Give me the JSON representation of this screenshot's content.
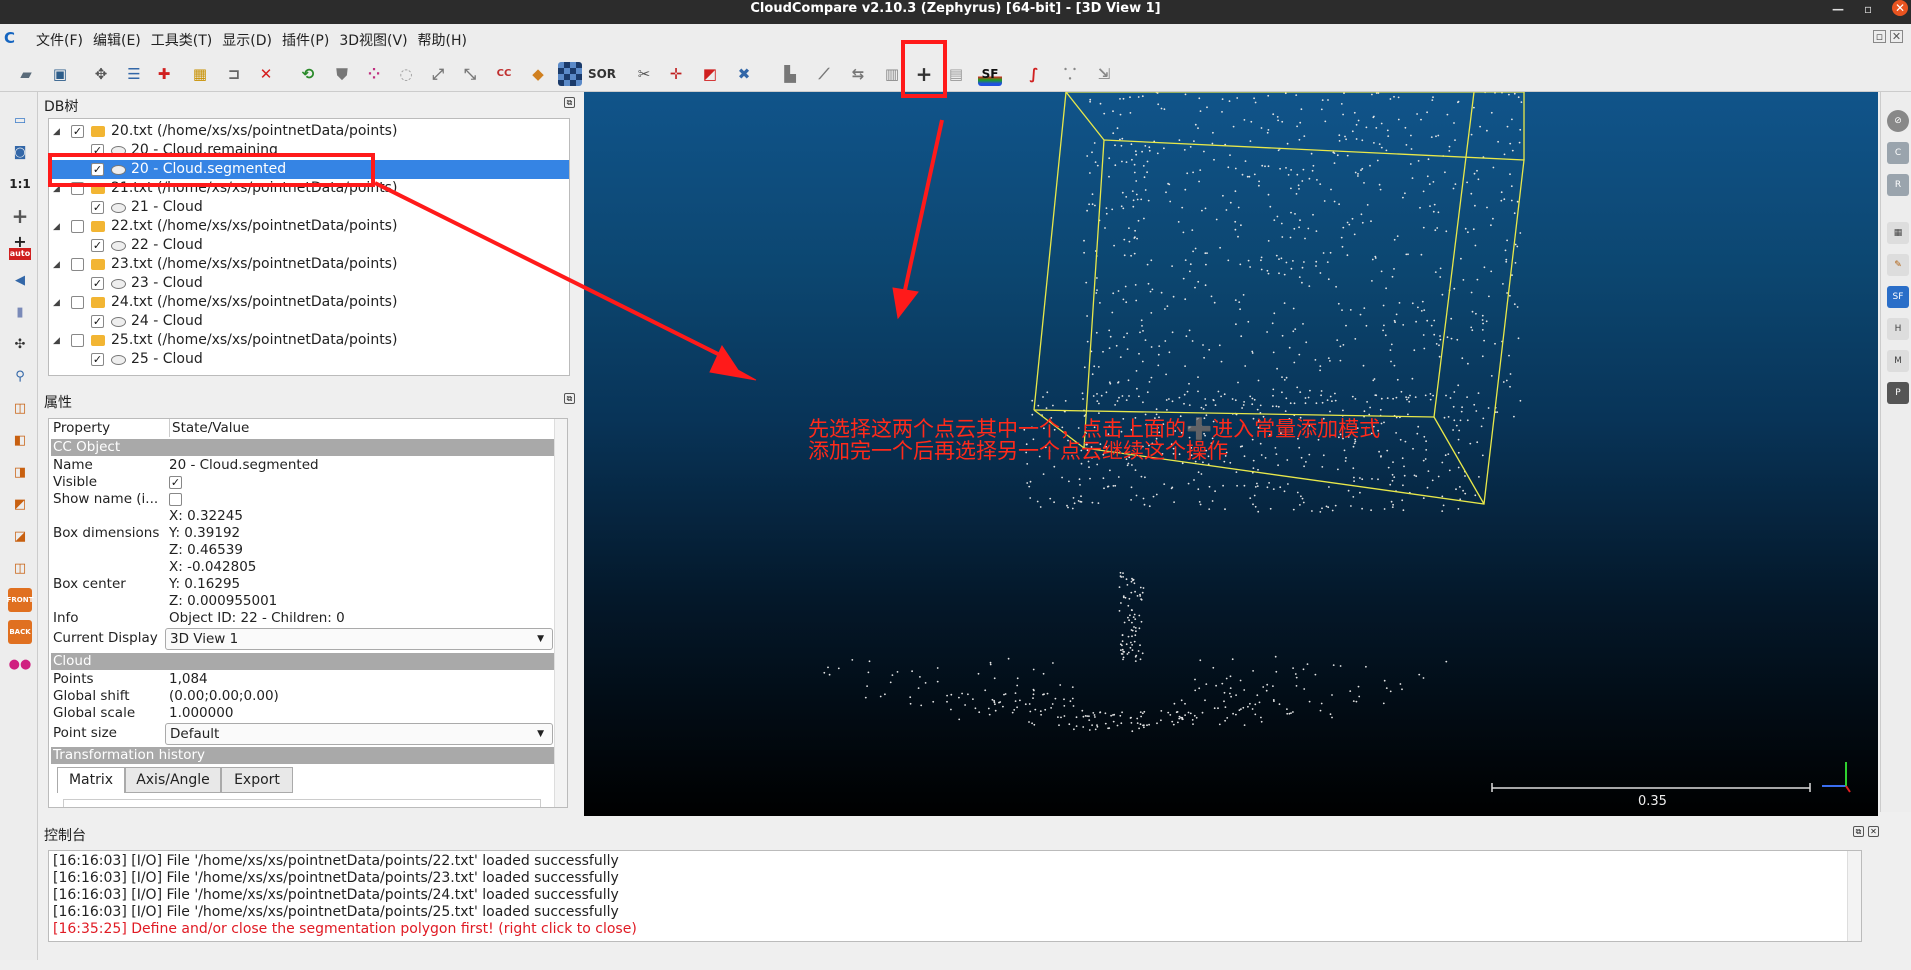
{
  "window": {
    "title": "CloudCompare v2.10.3 (Zephyrus) [64-bit] - [3D View 1]"
  },
  "menu": [
    "文件(F)",
    "编辑(E)",
    "工具类(T)",
    "显示(D)",
    "插件(P)",
    "3D视图(V)",
    "帮助(H)"
  ],
  "toolbar": {
    "icons": [
      "open-icon",
      "save-icon",
      "pick-icon",
      "list-icon",
      "clone-icon",
      "merge-icon",
      "segment-icon",
      "delete-icon",
      "color-icon",
      "normal-icon",
      "sample-icon",
      "mesh-icon",
      "registration-icon",
      "distance-icon",
      "cc-icon",
      "scalar-icon",
      "checker-icon",
      "sor-icon",
      "section-icon",
      "translate-icon",
      "plane-icon",
      "cross-icon",
      "histogram-icon",
      "plot-icon",
      "minmax-icon",
      "table-icon",
      "add-constant-icon",
      "calc-icon",
      "sf-icon",
      "label-icon",
      "cloud-icon",
      "export-icon"
    ],
    "sor_label": "SOR",
    "sf_label": "SF",
    "cc_label": "CC"
  },
  "left_toolbar": {
    "scale_label": "1:1",
    "auto_label": "auto",
    "front_label": "FRONT",
    "back_label": "BACK"
  },
  "dbtree": {
    "title": "DB树",
    "items": [
      {
        "label": "20.txt (/home/xs/xs/pointnetData/points)",
        "level": 0,
        "checked": true
      },
      {
        "label": "20 - Cloud.remaining",
        "level": 1,
        "checked": true
      },
      {
        "label": "20 - Cloud.segmented",
        "level": 1,
        "checked": true,
        "selected": true
      },
      {
        "label": "21.txt (/home/xs/xs/pointnetData/points)",
        "level": 0,
        "checked": false
      },
      {
        "label": "21 - Cloud",
        "level": 1,
        "checked": true
      },
      {
        "label": "22.txt (/home/xs/xs/pointnetData/points)",
        "level": 0,
        "checked": false
      },
      {
        "label": "22 - Cloud",
        "level": 1,
        "checked": true
      },
      {
        "label": "23.txt (/home/xs/xs/pointnetData/points)",
        "level": 0,
        "checked": false
      },
      {
        "label": "23 - Cloud",
        "level": 1,
        "checked": true
      },
      {
        "label": "24.txt (/home/xs/xs/pointnetData/points)",
        "level": 0,
        "checked": false
      },
      {
        "label": "24 - Cloud",
        "level": 1,
        "checked": true
      },
      {
        "label": "25.txt (/home/xs/xs/pointnetData/points)",
        "level": 0,
        "checked": false
      },
      {
        "label": "25 - Cloud",
        "level": 1,
        "checked": true
      }
    ]
  },
  "properties": {
    "title": "属性",
    "header_property": "Property",
    "header_value": "State/Value",
    "section_ccobject": "CC Object",
    "name_k": "Name",
    "name_v": "20 - Cloud.segmented",
    "visible_k": "Visible",
    "showname_k": "Show name (i...",
    "boxdim_k": "Box dimensions",
    "boxdim_x": "X: 0.32245",
    "boxdim_y": "Y: 0.39192",
    "boxdim_z": "Z: 0.46539",
    "boxcenter_k": "Box center",
    "boxcenter_x": "X: -0.042805",
    "boxcenter_y": "Y: 0.16295",
    "boxcenter_z": "Z: 0.000955001",
    "info_k": "Info",
    "info_v": "Object ID: 22 - Children: 0",
    "display_k": "Current Display",
    "display_v": "3D View 1",
    "section_cloud": "Cloud",
    "points_k": "Points",
    "points_v": "1,084",
    "gshift_k": "Global shift",
    "gshift_v": "(0.00;0.00;0.00)",
    "gscale_k": "Global scale",
    "gscale_v": "1.000000",
    "psize_k": "Point size",
    "psize_v": "Default",
    "section_transform": "Transformation history",
    "tabs": [
      "Matrix",
      "Axis/Angle",
      "Export"
    ]
  },
  "view3d": {
    "scale_value": "0.35"
  },
  "annotation": {
    "line1": "先选择这两个点云其中一个，点击上面的➕进入常量添加模式",
    "line2": "添加完一个后再选择另一个点云继续这个操作"
  },
  "console": {
    "title": "控制台",
    "lines": [
      {
        "text": "[16:16:03] [I/O] File '/home/xs/xs/pointnetData/points/22.txt' loaded successfully",
        "error": false
      },
      {
        "text": "[16:16:03] [I/O] File '/home/xs/xs/pointnetData/points/23.txt' loaded successfully",
        "error": false
      },
      {
        "text": "[16:16:03] [I/O] File '/home/xs/xs/pointnetData/points/24.txt' loaded successfully",
        "error": false
      },
      {
        "text": "[16:16:03] [I/O] File '/home/xs/xs/pointnetData/points/25.txt' loaded successfully",
        "error": false
      },
      {
        "text": "[16:35:25] Define and/or close the segmentation polygon first! (right click to close)",
        "error": true
      }
    ]
  },
  "colors": {
    "selection": "#3584e4",
    "annotation": "#ff1a1a",
    "error_text": "#e01b24",
    "bbox": "#e8e84a"
  }
}
